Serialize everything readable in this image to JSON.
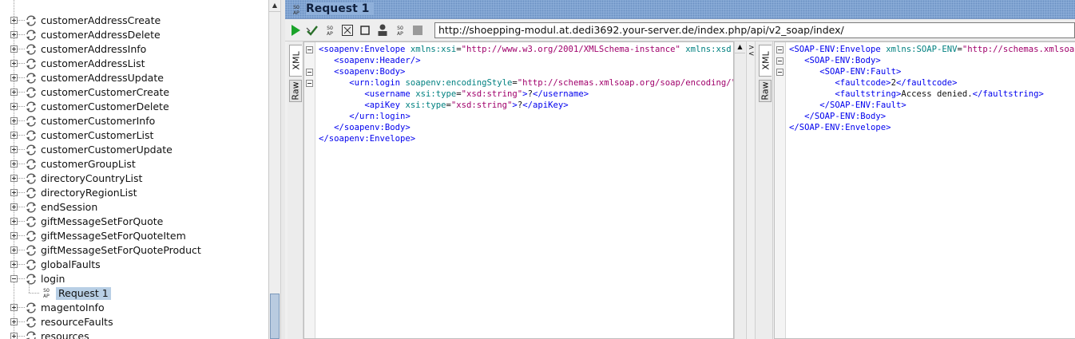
{
  "tree": {
    "nodes": [
      {
        "label": "customerAddressCreate"
      },
      {
        "label": "customerAddressDelete"
      },
      {
        "label": "customerAddressInfo"
      },
      {
        "label": "customerAddressList"
      },
      {
        "label": "customerAddressUpdate"
      },
      {
        "label": "customerCustomerCreate"
      },
      {
        "label": "customerCustomerDelete"
      },
      {
        "label": "customerCustomerInfo"
      },
      {
        "label": "customerCustomerList"
      },
      {
        "label": "customerCustomerUpdate"
      },
      {
        "label": "customerGroupList"
      },
      {
        "label": "directoryCountryList"
      },
      {
        "label": "directoryRegionList"
      },
      {
        "label": "endSession"
      },
      {
        "label": "giftMessageSetForQuote"
      },
      {
        "label": "giftMessageSetForQuoteItem"
      },
      {
        "label": "giftMessageSetForQuoteProduct"
      },
      {
        "label": "globalFaults"
      },
      {
        "label": "login"
      },
      {
        "label": "magentoInfo"
      },
      {
        "label": "resourceFaults"
      },
      {
        "label": "resources"
      }
    ],
    "request_child": "Request 1",
    "soap_icon_text": [
      "SO",
      "AP"
    ]
  },
  "request": {
    "title": "Request 1",
    "endpoint": "http://shoepping-modul.at.dedi3692.your-server.de/index.php/api/v2_soap/index/",
    "tabs": {
      "xml": "XML",
      "raw": "Raw"
    }
  },
  "toolbar": {
    "icons": [
      "run-icon",
      "validate-icon",
      "soap-icon",
      "expand-icon",
      "stop-icon",
      "user-icon",
      "soap-icon",
      "cancel-icon"
    ]
  },
  "colors": {
    "title_bar": "#8fb0da",
    "selection": "#b8cfe5",
    "tag": "#0000ee",
    "attribute": "#008080",
    "attr_value": "#a0006b"
  }
}
